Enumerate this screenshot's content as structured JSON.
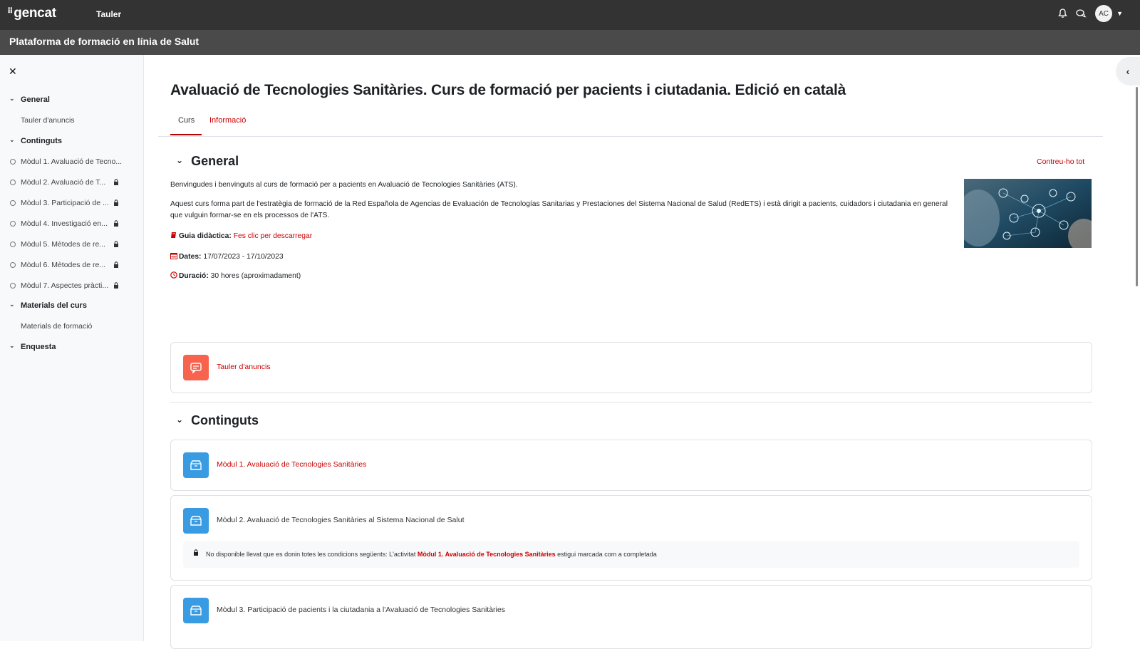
{
  "topbar": {
    "logo": "gencat",
    "nav_link": "Tauler",
    "avatar_initials": "AC"
  },
  "site": {
    "title": "Plataforma de formació en línia de Salut"
  },
  "course_index": {
    "sections": [
      {
        "label": "General",
        "items": [
          {
            "label": "Tauler d'anuncis"
          }
        ]
      },
      {
        "label": "Continguts",
        "items": [
          {
            "label": "Mòdul 1. Avaluació de Tecno...",
            "locked": false
          },
          {
            "label": "Mòdul 2. Avaluació de T...",
            "locked": true
          },
          {
            "label": "Mòdul 3. Participació de ...",
            "locked": true
          },
          {
            "label": "Mòdul 4. Investigació en...",
            "locked": true
          },
          {
            "label": "Mòdul 5. Mètodes de re...",
            "locked": true
          },
          {
            "label": "Mòdul 6. Mètodes de re...",
            "locked": true
          },
          {
            "label": "Mòdul 7. Aspectes pràcti...",
            "locked": true
          }
        ]
      },
      {
        "label": "Materials del curs",
        "items": [
          {
            "label": "Materials de formació"
          }
        ]
      },
      {
        "label": "Enquesta",
        "items": []
      }
    ]
  },
  "course": {
    "title": "Avaluació de Tecnologies Sanitàries. Curs de formació per pacients i ciutadania. Edició en català",
    "tabs": {
      "course": "Curs",
      "info": "Informació"
    },
    "collapse_all": "Contreu-ho tot",
    "general": {
      "heading": "General",
      "intro": "Benvingudes i benvinguts al curs de formació per a pacients en Avaluació de Tecnologies Sanitàries (ATS).",
      "description_line1": "Aquest curs forma part de l'estratègia de formació de la Red Española de Agencias de Evaluación de Tecnologías Sanitarias y Prestaciones del Sistema Nacional de Salud (RedETS) i està dirigit a pacients, cuidadors i ciutadania en general",
      "description_line2": "que vulguin formar-se en els processos de l'ATS.",
      "guide_label": "Guia didàctica:",
      "guide_link": "Fes clic per descarregar",
      "dates_label": "Dates:",
      "dates_value": "17/07/2023 - 17/10/2023",
      "duration_label": "Duració:",
      "duration_value": "30 hores (aproximadament)",
      "forum": "Tauler d'anuncis"
    },
    "contents": {
      "heading": "Continguts",
      "modules": [
        {
          "name": "Mòdul 1. Avaluació de Tecnologies Sanitàries"
        },
        {
          "name": "Mòdul 2. Avaluació de Tecnologies Sanitàries al Sistema Nacional de Salut",
          "restriction_pre": "No disponible llevat que es donin totes les condicions següents: L'activitat",
          "restriction_link": "Mòdul 1. Avaluació de Tecnologies Sanitàries",
          "restriction_post": "estigui marcada com a completada"
        },
        {
          "name": "Mòdul 3. Participació de pacients i la ciutadania a l'Avaluació de Tecnologies Sanitàries"
        }
      ]
    }
  },
  "colors": {
    "accent": "#c00000",
    "topbar": "#333333",
    "orange_icon": "#f7634d",
    "blue_icon": "#399be2"
  }
}
